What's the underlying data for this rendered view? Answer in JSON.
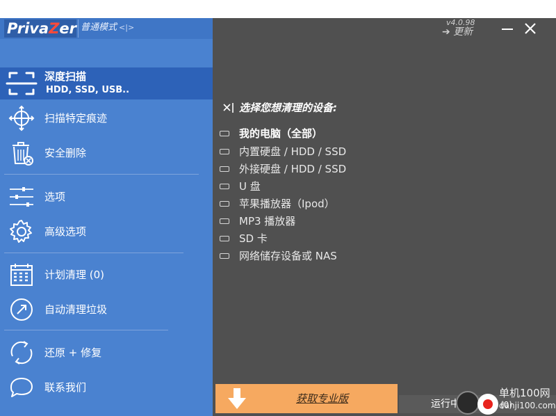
{
  "app": {
    "logo_prefix": "Priva",
    "logo_z": "Z",
    "logo_suffix": "er",
    "mode": "普通模式",
    "mode_arrows": "<|>",
    "version": "v4.0.98",
    "update": "➔ 更新"
  },
  "nav": {
    "deep_scan": {
      "label": "深度扫描",
      "sub": "HDD, SSD, USB.."
    },
    "scan_traces": {
      "label": "扫描特定痕迹"
    },
    "secure_delete": {
      "label": "安全删除"
    },
    "options": {
      "label": "选项"
    },
    "advanced_options": {
      "label": "高级选项"
    },
    "scheduled_clean": {
      "label": "计划清理 (0)"
    },
    "auto_clean": {
      "label": "自动清理垃圾"
    },
    "restore_repair": {
      "label": "还原 + 修复"
    },
    "contact": {
      "label": "联系我们"
    }
  },
  "main": {
    "heading": "选择您想清理的设备:",
    "devices": [
      "我的电脑（全部）",
      "内置硬盘 / HDD / SSD",
      "外接硬盘  / HDD / SSD",
      "U 盘",
      "苹果播放器（Ipod）",
      "MP3 播放器",
      "SD 卡",
      "网络储存设备或 NAS"
    ],
    "get_pro": "获取专业版",
    "running_label": "运行中的",
    "running_count": "(0)"
  },
  "watermark": {
    "line1": "单机100网",
    "line2": "danji100.com"
  },
  "colors": {
    "left_panel": "#4a82d0",
    "active_item": "#2d62b8",
    "right_panel": "#505050",
    "pro_button": "#f6a960",
    "logo_accent": "#ff4a3a"
  }
}
